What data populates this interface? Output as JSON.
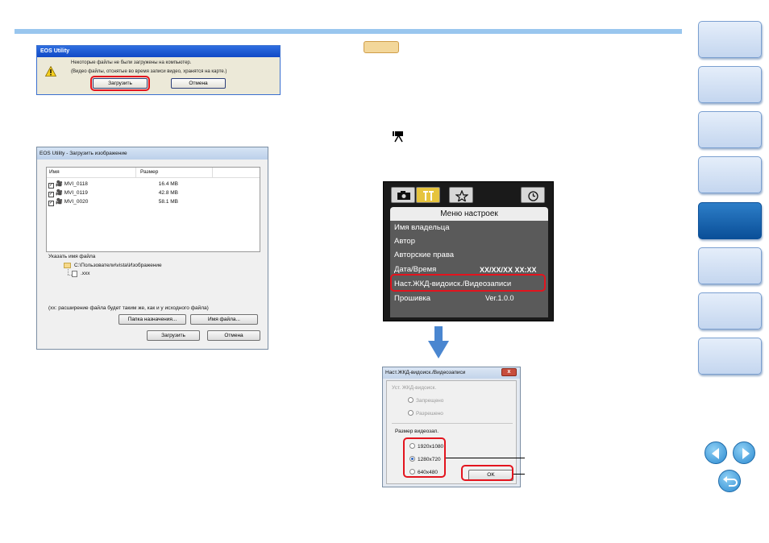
{
  "dialog_download": {
    "title": "EOS Utility",
    "message_line1": "Некоторые файлы не были загружены на компьютер.",
    "message_line2": "(Видео файлы, отснятые во время записи видео, хранятся на карте.)",
    "download_button": "Загрузить",
    "cancel_button": "Отмена"
  },
  "dialog_images": {
    "title": "EOS Utility - Загрузить изображение",
    "col_name": "Имя",
    "col_size": "Размер",
    "files": [
      {
        "name": "MVI_0118",
        "size": "16.4 MB"
      },
      {
        "name": "MVI_0119",
        "size": "42.8 MB"
      },
      {
        "name": "MVI_0020",
        "size": "58.1 MB"
      }
    ],
    "filename_label": "Указать имя файла",
    "folder_path": "C:\\Пользователи\\vista\\Изображение",
    "file_pattern": ".xxx",
    "note": "(xx: расширение файла будет таким же, как и у исходного файла)",
    "destination_button": "Папка назначения...",
    "filename_button": "Имя файла...",
    "download_button": "Загрузить",
    "cancel_button": "Отмена"
  },
  "camera_menu": {
    "header": "Меню настроек",
    "items": [
      {
        "label": "Имя владельца",
        "value": ""
      },
      {
        "label": "Автор",
        "value": ""
      },
      {
        "label": "Авторские права",
        "value": ""
      },
      {
        "label": "Дата/Время",
        "value": "XX/XX/XX XX:XX"
      },
      {
        "label": "Наст.ЖКД-видоиск./Видеозаписи",
        "value": ""
      },
      {
        "label": "Прошивка",
        "value": "Ver.1.0.0"
      }
    ]
  },
  "dialog_video": {
    "title": "Наст.ЖКД-видоиск./Видеозаписи",
    "close_glyph": "x",
    "lcd_group_label": "Уст. ЖКД-видоиск.",
    "lcd_options": [
      "Запрещено",
      "Разрешено"
    ],
    "size_group_label": "Размер видеозап.",
    "size_options": [
      "1920x1080",
      "1280x720",
      "640x480"
    ],
    "selected_size": "1280x720",
    "ok_button": "OK"
  },
  "colors": {
    "highlight": "#e3141e",
    "accent_blue": "#2d7ec8",
    "note_tag": "#f3d79a"
  }
}
